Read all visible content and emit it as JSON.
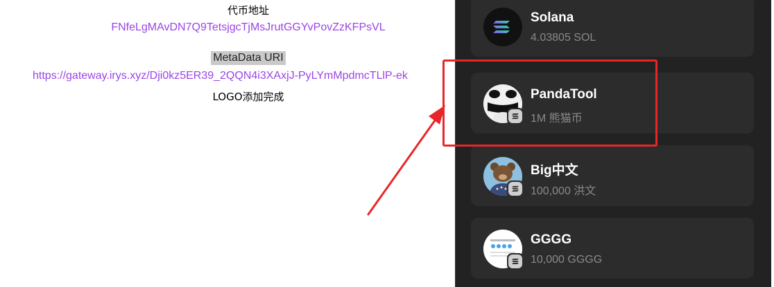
{
  "left": {
    "token_address_label": "代币地址",
    "token_address": "FNfeLgMAvDN7Q9TetsjgcTjMsJrutGGYvPovZzKFPsVL",
    "metadata_label": "MetaData URI",
    "metadata_uri": "https://gateway.irys.xyz/Dji0kz5ER39_2QQN4i3XAxjJ-PyLYmMpdmcTLlP-ek",
    "logo_status": "LOGO添加完成"
  },
  "wallet": {
    "tokens": [
      {
        "name": "Solana",
        "amount": "4.03805 SOL",
        "icon": "solana-logo-icon"
      },
      {
        "name": "PandaTool",
        "amount": "1M 熊猫币",
        "icon": "panda-avatar-icon"
      },
      {
        "name": "Big中文",
        "amount": "100,000 洪文",
        "icon": "bear-avatar-icon"
      },
      {
        "name": "GGGG",
        "amount": "10,000 GGGG",
        "icon": "app-screenshot-avatar-icon"
      }
    ]
  },
  "colors": {
    "link": "#9b44e6",
    "panel_bg": "#222222",
    "card_bg": "#2c2c2c",
    "annotation": "#e8262a"
  }
}
